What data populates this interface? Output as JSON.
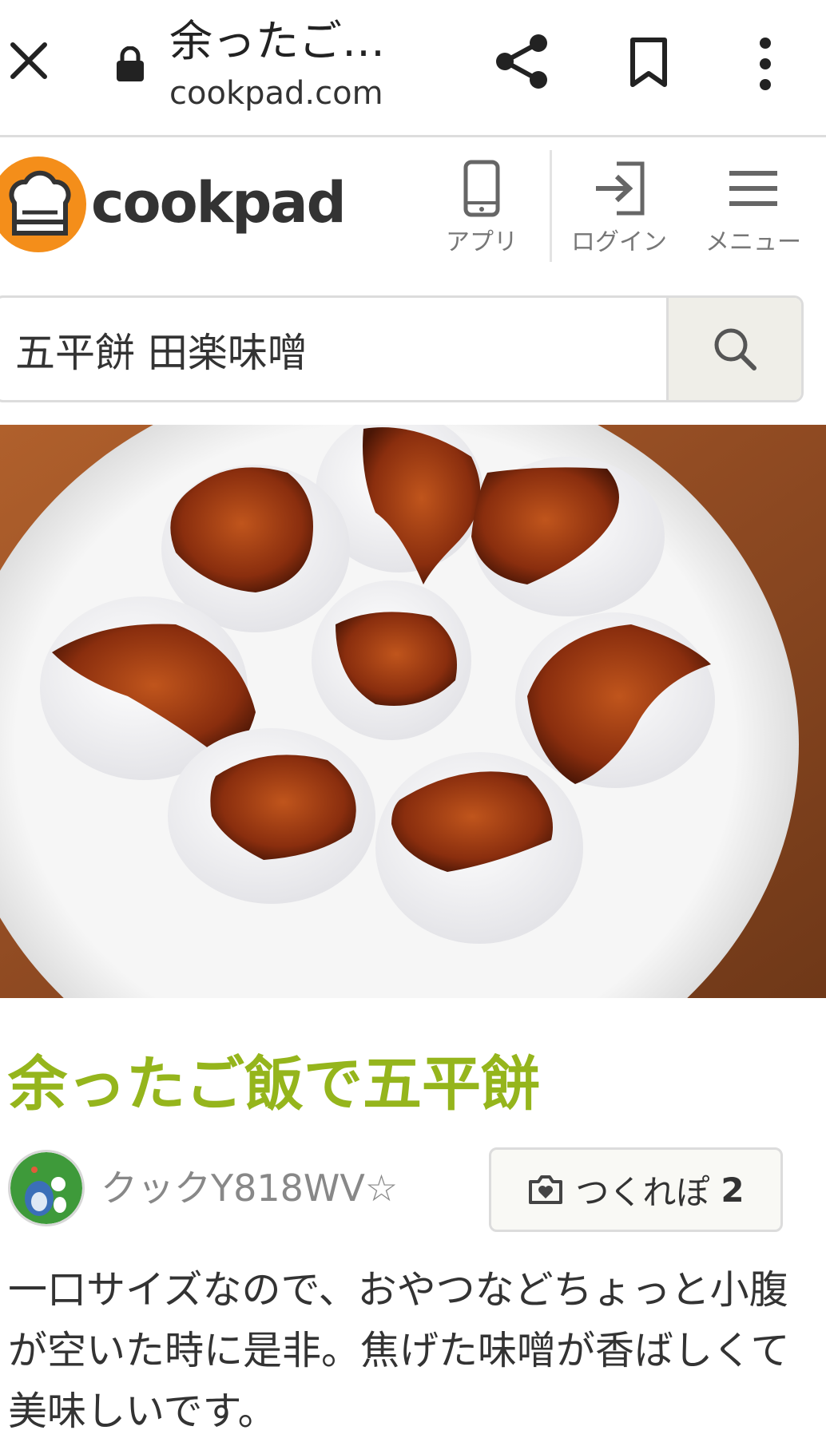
{
  "browser": {
    "tab_title": "余ったご…",
    "url": "cookpad.com",
    "icons": [
      "close-icon",
      "lock-icon",
      "share-icon",
      "bookmark-icon",
      "more-vert-icon"
    ]
  },
  "header": {
    "logo_text": "cookpad",
    "app_label": "アプリ",
    "login_label": "ログイン",
    "menu_label": "メニュー"
  },
  "search": {
    "value": "五平餅 田楽味噌"
  },
  "recipe": {
    "title": "余ったご飯で五平餅",
    "author": "クックY818WV☆",
    "tsukurepo_label": "つくれぽ",
    "tsukurepo_count": "2",
    "description": "一口サイズなので、おやつなどちょっと小腹が空いた時に是非。焦げた味噌が香ばしくて美味しいです。"
  },
  "colors": {
    "title_green": "#95b51c",
    "logo_orange": "#f48e1a",
    "search_button_bg": "#efeee8"
  }
}
